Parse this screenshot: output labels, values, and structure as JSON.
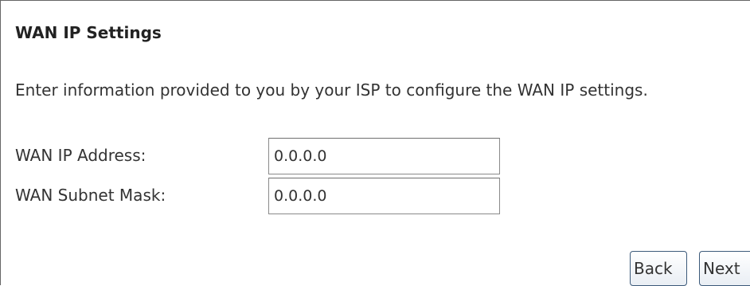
{
  "section": {
    "title": "WAN IP Settings",
    "description": "Enter information provided to you by your ISP to configure the WAN IP settings."
  },
  "fields": [
    {
      "label": "WAN IP Address:",
      "value": "0.0.0.0"
    },
    {
      "label": "WAN Subnet Mask:",
      "value": "0.0.0.0"
    }
  ],
  "buttons": {
    "back_label": "Back",
    "next_label": "Next"
  }
}
